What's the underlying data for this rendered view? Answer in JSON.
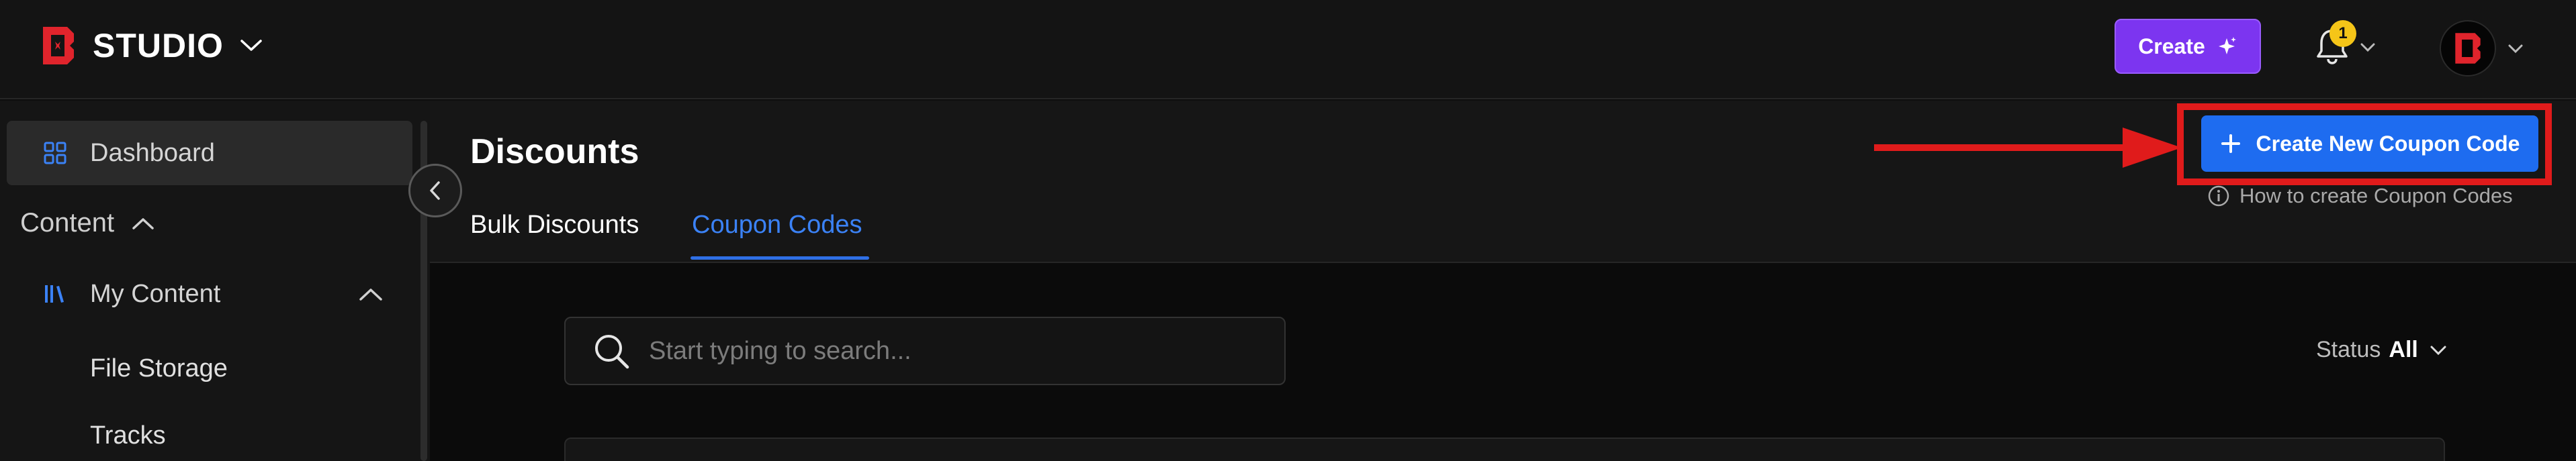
{
  "brand": {
    "name": "STUDIO"
  },
  "topbar": {
    "create_label": "Create",
    "notification_count": "1"
  },
  "sidebar": {
    "dashboard_label": "Dashboard",
    "section_content": "Content",
    "my_content_label": "My Content",
    "sub_items": [
      "File Storage",
      "Tracks"
    ]
  },
  "main": {
    "page_title": "Discounts",
    "tabs": [
      {
        "label": "Bulk Discounts",
        "active": false
      },
      {
        "label": "Coupon Codes",
        "active": true
      }
    ],
    "new_coupon_button": "Create New Coupon Code",
    "howto_link": "How to create Coupon Codes",
    "search_placeholder": "Start typing to search...",
    "status_label": "Status",
    "status_value": "All"
  },
  "colors": {
    "brand_red": "#e0242c",
    "create_purple": "#7c35f0",
    "primary_blue": "#1e6cf0",
    "active_tab_blue": "#3b82f6",
    "annotation_red": "#e01b1b",
    "badge_yellow": "#f5c518"
  },
  "icons": [
    "studio-logo-icon",
    "chevron-down-icon",
    "sparkle-icon",
    "bell-icon",
    "grid-icon",
    "chevron-up-icon",
    "library-icon",
    "chevron-left-icon",
    "plus-icon",
    "info-icon",
    "search-icon",
    "arrow-right-icon"
  ]
}
